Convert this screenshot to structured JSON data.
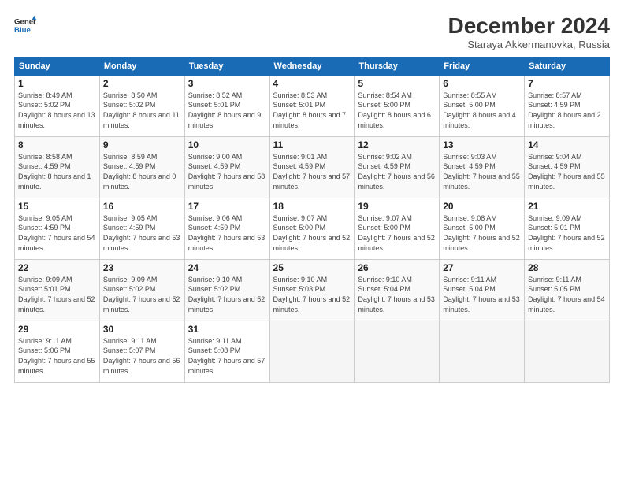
{
  "header": {
    "logo_line1": "General",
    "logo_line2": "Blue",
    "month_title": "December 2024",
    "location": "Staraya Akkermanovka, Russia"
  },
  "weekdays": [
    "Sunday",
    "Monday",
    "Tuesday",
    "Wednesday",
    "Thursday",
    "Friday",
    "Saturday"
  ],
  "weeks": [
    [
      {
        "day": "1",
        "sunrise": "8:49 AM",
        "sunset": "5:02 PM",
        "daylight": "8 hours and 13 minutes."
      },
      {
        "day": "2",
        "sunrise": "8:50 AM",
        "sunset": "5:02 PM",
        "daylight": "8 hours and 11 minutes."
      },
      {
        "day": "3",
        "sunrise": "8:52 AM",
        "sunset": "5:01 PM",
        "daylight": "8 hours and 9 minutes."
      },
      {
        "day": "4",
        "sunrise": "8:53 AM",
        "sunset": "5:01 PM",
        "daylight": "8 hours and 7 minutes."
      },
      {
        "day": "5",
        "sunrise": "8:54 AM",
        "sunset": "5:00 PM",
        "daylight": "8 hours and 6 minutes."
      },
      {
        "day": "6",
        "sunrise": "8:55 AM",
        "sunset": "5:00 PM",
        "daylight": "8 hours and 4 minutes."
      },
      {
        "day": "7",
        "sunrise": "8:57 AM",
        "sunset": "4:59 PM",
        "daylight": "8 hours and 2 minutes."
      }
    ],
    [
      {
        "day": "8",
        "sunrise": "8:58 AM",
        "sunset": "4:59 PM",
        "daylight": "8 hours and 1 minute."
      },
      {
        "day": "9",
        "sunrise": "8:59 AM",
        "sunset": "4:59 PM",
        "daylight": "8 hours and 0 minutes."
      },
      {
        "day": "10",
        "sunrise": "9:00 AM",
        "sunset": "4:59 PM",
        "daylight": "7 hours and 58 minutes."
      },
      {
        "day": "11",
        "sunrise": "9:01 AM",
        "sunset": "4:59 PM",
        "daylight": "7 hours and 57 minutes."
      },
      {
        "day": "12",
        "sunrise": "9:02 AM",
        "sunset": "4:59 PM",
        "daylight": "7 hours and 56 minutes."
      },
      {
        "day": "13",
        "sunrise": "9:03 AM",
        "sunset": "4:59 PM",
        "daylight": "7 hours and 55 minutes."
      },
      {
        "day": "14",
        "sunrise": "9:04 AM",
        "sunset": "4:59 PM",
        "daylight": "7 hours and 55 minutes."
      }
    ],
    [
      {
        "day": "15",
        "sunrise": "9:05 AM",
        "sunset": "4:59 PM",
        "daylight": "7 hours and 54 minutes."
      },
      {
        "day": "16",
        "sunrise": "9:05 AM",
        "sunset": "4:59 PM",
        "daylight": "7 hours and 53 minutes."
      },
      {
        "day": "17",
        "sunrise": "9:06 AM",
        "sunset": "4:59 PM",
        "daylight": "7 hours and 53 minutes."
      },
      {
        "day": "18",
        "sunrise": "9:07 AM",
        "sunset": "5:00 PM",
        "daylight": "7 hours and 52 minutes."
      },
      {
        "day": "19",
        "sunrise": "9:07 AM",
        "sunset": "5:00 PM",
        "daylight": "7 hours and 52 minutes."
      },
      {
        "day": "20",
        "sunrise": "9:08 AM",
        "sunset": "5:00 PM",
        "daylight": "7 hours and 52 minutes."
      },
      {
        "day": "21",
        "sunrise": "9:09 AM",
        "sunset": "5:01 PM",
        "daylight": "7 hours and 52 minutes."
      }
    ],
    [
      {
        "day": "22",
        "sunrise": "9:09 AM",
        "sunset": "5:01 PM",
        "daylight": "7 hours and 52 minutes."
      },
      {
        "day": "23",
        "sunrise": "9:09 AM",
        "sunset": "5:02 PM",
        "daylight": "7 hours and 52 minutes."
      },
      {
        "day": "24",
        "sunrise": "9:10 AM",
        "sunset": "5:02 PM",
        "daylight": "7 hours and 52 minutes."
      },
      {
        "day": "25",
        "sunrise": "9:10 AM",
        "sunset": "5:03 PM",
        "daylight": "7 hours and 52 minutes."
      },
      {
        "day": "26",
        "sunrise": "9:10 AM",
        "sunset": "5:04 PM",
        "daylight": "7 hours and 53 minutes."
      },
      {
        "day": "27",
        "sunrise": "9:11 AM",
        "sunset": "5:04 PM",
        "daylight": "7 hours and 53 minutes."
      },
      {
        "day": "28",
        "sunrise": "9:11 AM",
        "sunset": "5:05 PM",
        "daylight": "7 hours and 54 minutes."
      }
    ],
    [
      {
        "day": "29",
        "sunrise": "9:11 AM",
        "sunset": "5:06 PM",
        "daylight": "7 hours and 55 minutes."
      },
      {
        "day": "30",
        "sunrise": "9:11 AM",
        "sunset": "5:07 PM",
        "daylight": "7 hours and 56 minutes."
      },
      {
        "day": "31",
        "sunrise": "9:11 AM",
        "sunset": "5:08 PM",
        "daylight": "7 hours and 57 minutes."
      },
      null,
      null,
      null,
      null
    ]
  ]
}
